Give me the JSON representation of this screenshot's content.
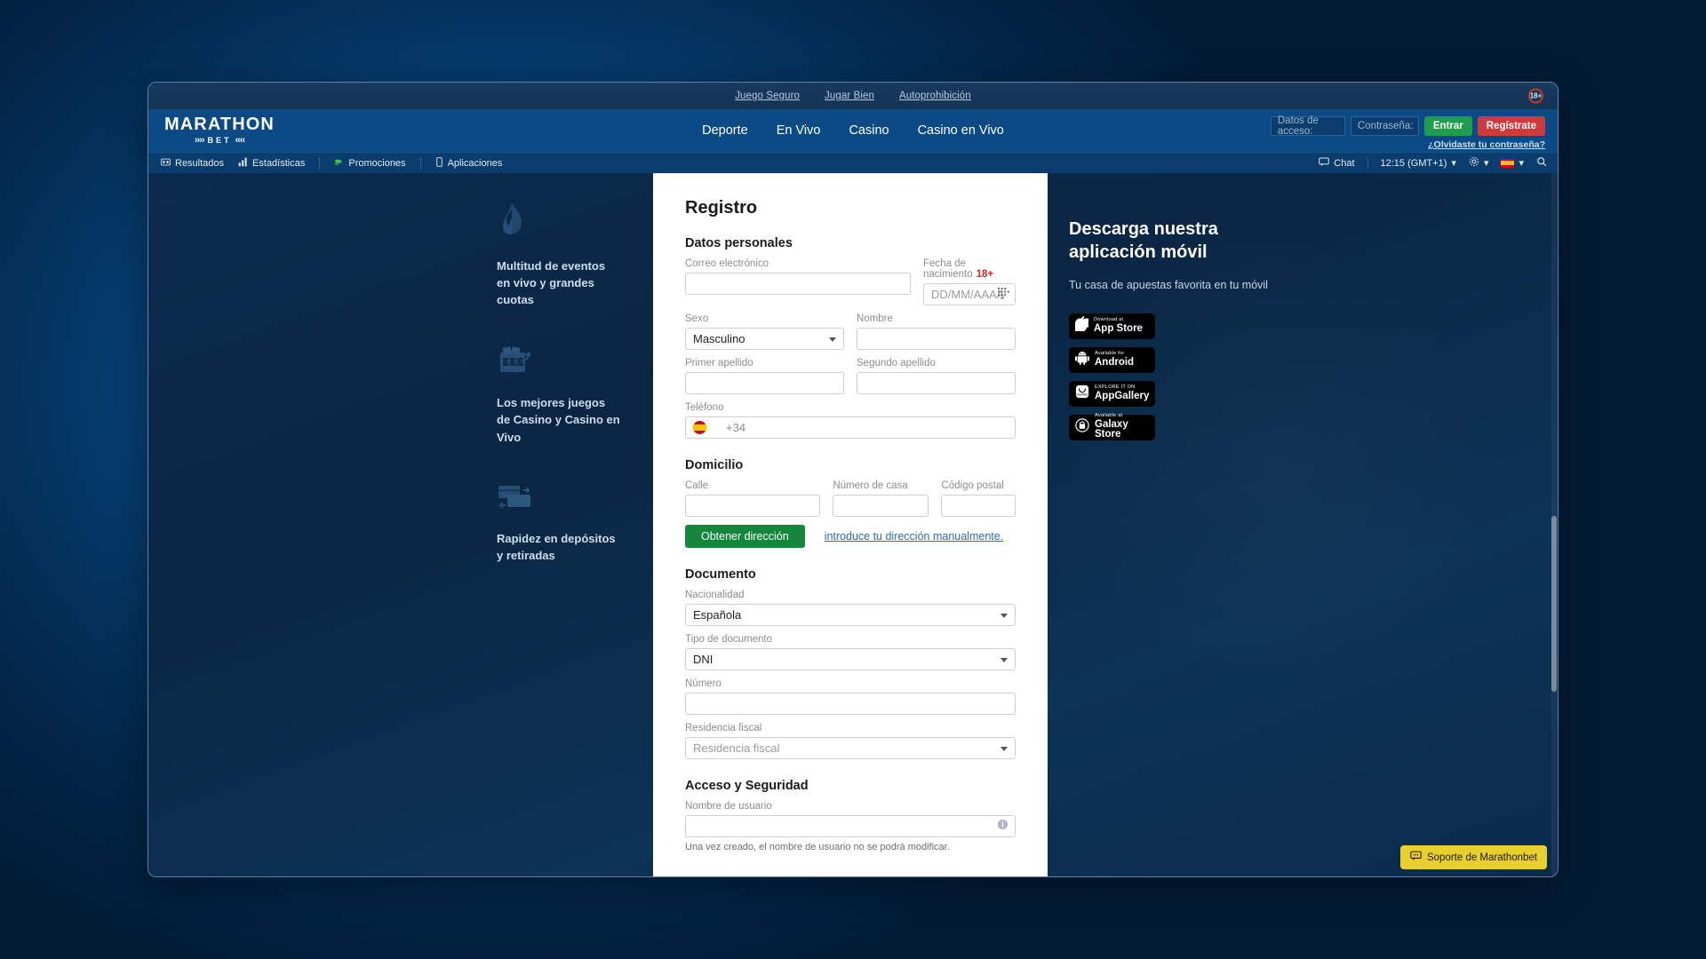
{
  "topbar": {
    "links": [
      "Juego Seguro",
      "Jugar Bien",
      "Autoprohibición"
    ],
    "age_badge": "18+"
  },
  "header": {
    "logo_top": "MARATHON",
    "logo_bottom": "BET",
    "nav": [
      "Deporte",
      "En Vivo",
      "Casino",
      "Casino en Vivo"
    ],
    "login": {
      "username_placeholder": "Datos de acceso:",
      "username_value": "",
      "password_placeholder": "Contraseña:",
      "password_value": "",
      "login_button": "Entrar",
      "register_button": "Regístrate",
      "forgot_link": "¿Olvidaste tu contraseña?"
    }
  },
  "subnav": {
    "left": [
      {
        "label": "Resultados",
        "icon": "results-icon"
      },
      {
        "label": "Estadísticas",
        "icon": "stats-icon"
      },
      {
        "label": "Promociones",
        "icon": "promo-icon"
      },
      {
        "label": "Aplicaciones",
        "icon": "mobile-icon"
      }
    ],
    "right": {
      "chat": "Chat",
      "time": "12:15 (GMT+1)",
      "settings_icon": "gear-icon",
      "language_icon": "spain-flag-icon",
      "search_icon": "search-icon"
    }
  },
  "promo": [
    {
      "icon": "flame-icon",
      "text": "Multitud de eventos en vivo y grandes cuotas"
    },
    {
      "icon": "slot-machine-icon",
      "text": "Los mejores juegos de Casino y Casino en Vivo"
    },
    {
      "icon": "payment-card-icon",
      "text": "Rapidez en depósitos y retiradas"
    }
  ],
  "form": {
    "title": "Registro",
    "section_personal": "Datos personales",
    "email_label": "Correo electrónico",
    "email_value": "",
    "dob_label": "Fecha de nacimiento",
    "dob_required": "18+",
    "dob_placeholder": "DD/MM/AAAA",
    "dob_value": "",
    "sex_label": "Sexo",
    "sex_value": "Masculino",
    "firstname_label": "Nombre",
    "firstname_value": "",
    "surname1_label": "Primer apellido",
    "surname1_value": "",
    "surname2_label": "Segundo apellido",
    "surname2_value": "",
    "phone_label": "Teléfono",
    "phone_code": "+34",
    "phone_value": "",
    "section_address": "Domicilio",
    "street_label": "Calle",
    "street_value": "",
    "housenum_label": "Número de casa",
    "housenum_value": "",
    "postcode_label": "Código postal",
    "postcode_value": "",
    "get_address_button": "Obtener dirección",
    "manual_address_link": "introduce tu dirección manualmente.",
    "section_document": "Documento",
    "nationality_label": "Nacionalidad",
    "nationality_value": "Española",
    "doctype_label": "Tipo de documento",
    "doctype_value": "DNI",
    "docnum_label": "Número",
    "docnum_value": "",
    "taxres_label": "Residencia fiscal",
    "taxres_placeholder": "Residencia fiscal",
    "section_security": "Acceso y Seguridad",
    "username_label": "Nombre de usuario",
    "username_value": "",
    "username_helper": "Una vez creado, el nombre de usuario no se podrá modificar."
  },
  "app_panel": {
    "title": "Descarga nuestra aplicación móvil",
    "subtitle": "Tu casa de apuestas favorita en tu móvil",
    "badges": [
      {
        "small": "Download at",
        "large": "App Store",
        "icon": "apple-icon"
      },
      {
        "small": "Available for",
        "large": "Android",
        "icon": "android-icon"
      },
      {
        "small": "EXPLORE IT ON",
        "large": "AppGallery",
        "icon": "huawei-icon"
      },
      {
        "small": "Available at",
        "large": "Galaxy Store",
        "icon": "galaxy-icon"
      }
    ]
  },
  "support": {
    "label": "Soporte de Marathonbet",
    "icon": "chat-icon"
  },
  "colors": {
    "accent_green": "#1e9e4a",
    "accent_red": "#cf3b3b",
    "header_blue": "#0b4a85",
    "support_yellow": "#e8cf2b"
  }
}
